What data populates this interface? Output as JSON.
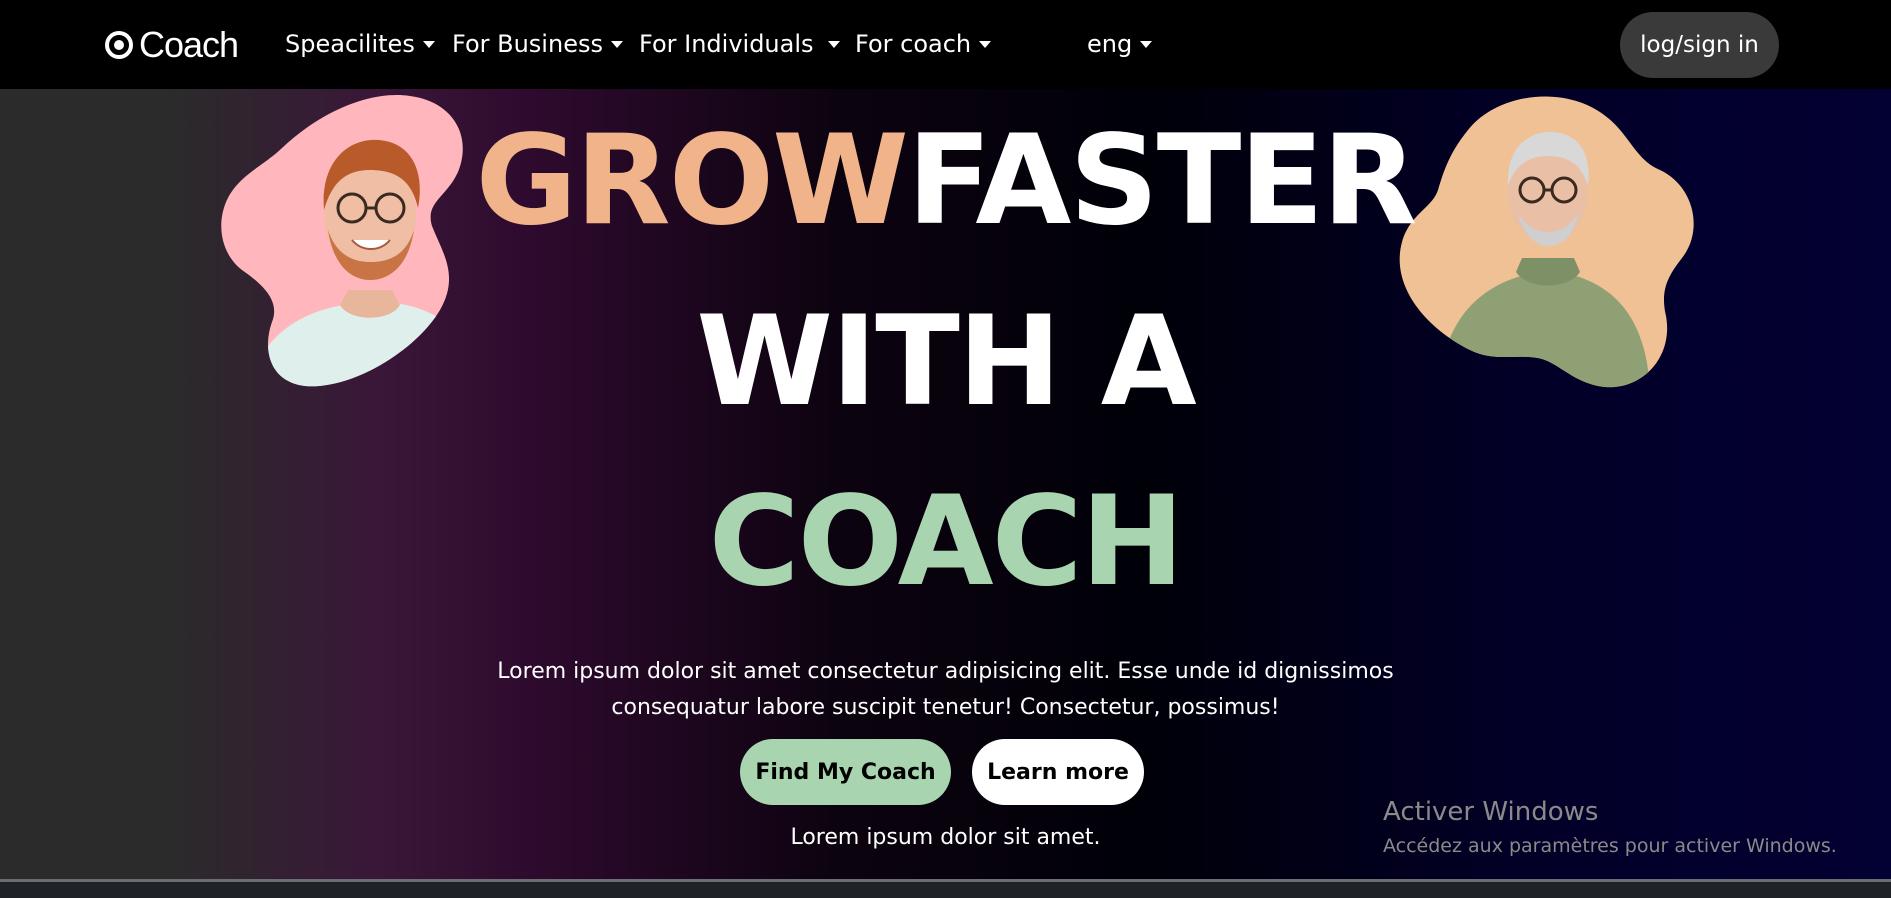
{
  "navbar": {
    "logo_text": "Coach",
    "items": [
      {
        "label": "Speacilites"
      },
      {
        "label": "For Business"
      },
      {
        "label": "For Individuals"
      },
      {
        "label": "For coach"
      }
    ],
    "language": "eng",
    "login_label": "log/sign in"
  },
  "hero": {
    "headline_grow": "GROW",
    "headline_faster": "FASTER",
    "headline_line2": "WITH A",
    "headline_line3": "COACH",
    "description": "Lorem ipsum dolor sit amet consectetur adipisicing elit. Esse unde id dignissimos consequatur labore suscipit tenetur! Consectetur, possimus!",
    "primary_button": "Find My Coach",
    "secondary_button": "Learn more",
    "footnote": "Lorem ipsum dolor sit amet."
  },
  "watermark": {
    "title": "Activer Windows",
    "subtitle": "Accédez aux paramètres pour activer Windows."
  },
  "colors": {
    "grow": "#f1b48a",
    "coach": "#a8d5b0",
    "nav_bg": "#000000",
    "left_blob": "#ffb7bd",
    "right_blob": "#efc194"
  }
}
